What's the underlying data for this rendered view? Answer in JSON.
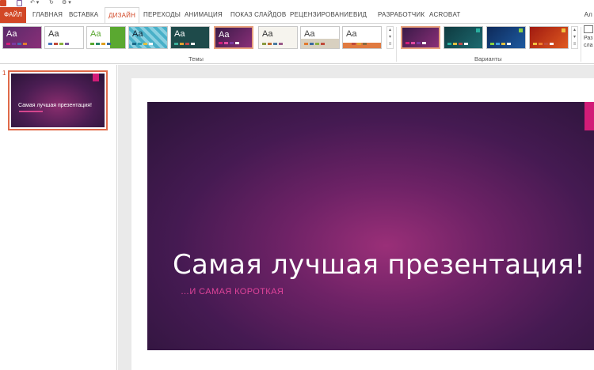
{
  "tabs": {
    "file": "ФАЙЛ",
    "items": [
      "ГЛАВНАЯ",
      "ВСТАВКА",
      "ДИЗАЙН",
      "ПЕРЕХОДЫ",
      "АНИМАЦИЯ",
      "ПОКАЗ СЛАЙДОВ",
      "РЕЦЕНЗИРОВАНИЕ",
      "ВИД",
      "РАЗРАБОТЧИК",
      "ACROBAT"
    ],
    "active": "ДИЗАЙН",
    "account": "Ал"
  },
  "ribbon": {
    "themes_label": "Темы",
    "variants_label": "Варианты",
    "theme_glyph": "Aa",
    "slide_size_label": "Раз сла",
    "colors": {
      "accent": "#d24726",
      "theme_magenta": "#d21c78"
    }
  },
  "slides_panel": {
    "slide_number": "1",
    "thumb_title": "Самая лучшая презентация!"
  },
  "slide": {
    "title": "Самая лучшая презентация!",
    "subtitle": "…И САМАЯ КОРОТКАЯ"
  }
}
